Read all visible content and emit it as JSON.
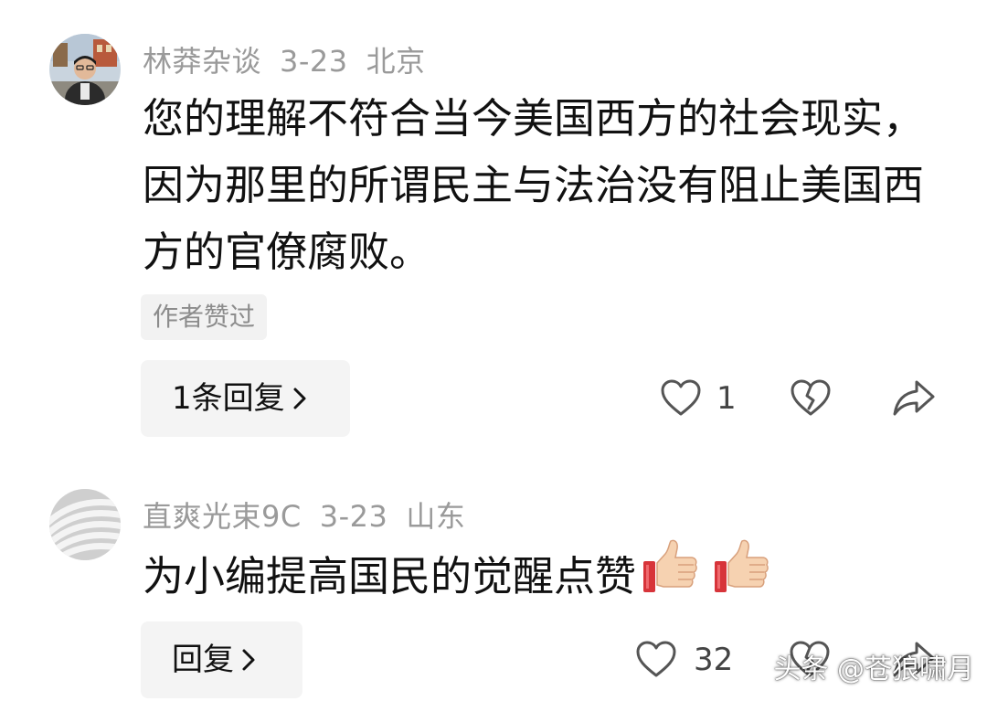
{
  "comments": [
    {
      "username": "林莽杂谈",
      "date": "3-23",
      "location": "北京",
      "avatar": "photo-avatar",
      "text": "您的理解不符合当今美国西方的社会现实，因为那里的所谓民主与法治没有阻止美国西方的官僚腐败。",
      "author_liked_badge": "作者赞过",
      "reply_label": "1条回复",
      "like_count": "1"
    },
    {
      "username": "直爽光束9C",
      "date": "3-23",
      "location": "山东",
      "avatar": "gray-swirl-avatar",
      "text": "为小编提高国民的觉醒点赞",
      "emojis": [
        "thumbs-up-icon",
        "thumbs-up-icon"
      ],
      "reply_label": "回复",
      "like_count": "32"
    }
  ],
  "watermark": "头条 @苍狼啸月",
  "colors": {
    "meta_text": "#9a9a9a",
    "body_text": "#111111",
    "button_bg": "#f4f4f4",
    "icon_stroke": "#555555"
  }
}
